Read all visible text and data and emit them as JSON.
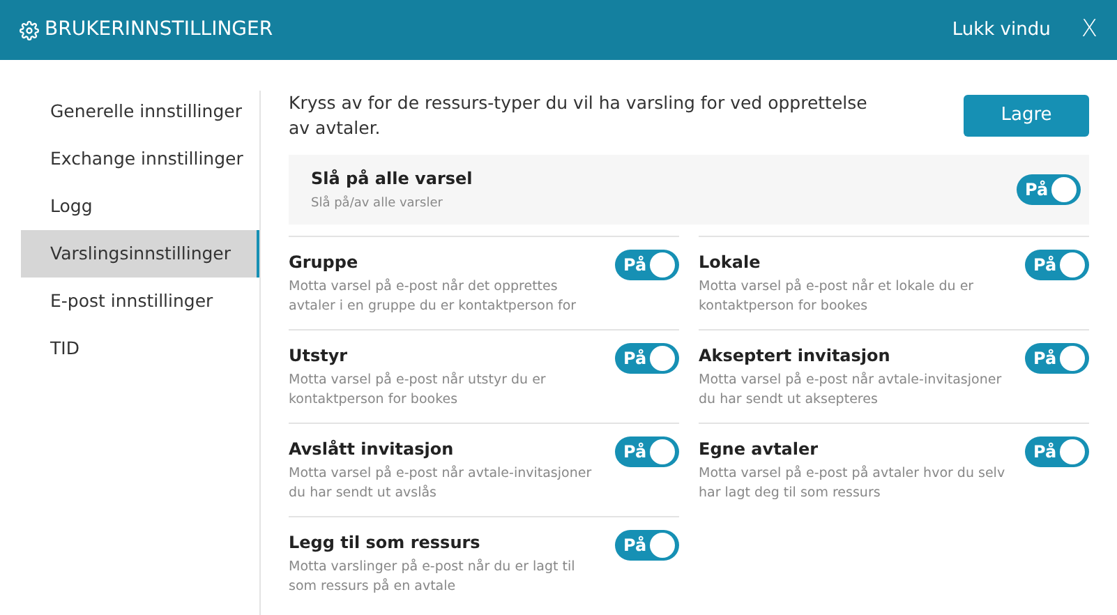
{
  "header": {
    "title": "BRUKERINNSTILLINGER",
    "close_label": "Lukk vindu",
    "close_icon": "X"
  },
  "sidebar": {
    "items": [
      {
        "label": "Generelle innstillinger",
        "selected": false
      },
      {
        "label": "Exchange innstillinger",
        "selected": false
      },
      {
        "label": "Logg",
        "selected": false
      },
      {
        "label": "Varslingsinnstillinger",
        "selected": true
      },
      {
        "label": "E-post innstillinger",
        "selected": false
      },
      {
        "label": "TID",
        "selected": false
      }
    ]
  },
  "intro": "Kryss av for de ressurs-typer du vil ha varsling for ved opprettelse av avtaler.",
  "save_button": "Lagre",
  "master": {
    "title": "Slå på alle varsel",
    "description": "Slå på/av alle varsler",
    "on": true,
    "toggle_label": "På"
  },
  "settings": [
    {
      "title": "Gruppe",
      "description": "Motta varsel på e-post når det opprettes avtaler i en gruppe du er kontaktperson for",
      "on": true,
      "toggle_label": "På"
    },
    {
      "title": "Lokale",
      "description": "Motta varsel på e-post når et lokale du er kontaktperson for bookes",
      "on": true,
      "toggle_label": "På"
    },
    {
      "title": "Utstyr",
      "description": "Motta varsel på e-post når utstyr du er kontaktperson for bookes",
      "on": true,
      "toggle_label": "På"
    },
    {
      "title": "Akseptert invitasjon",
      "description": "Motta varsel på e-post når avtale-invitasjoner du har sendt ut aksepteres",
      "on": true,
      "toggle_label": "På"
    },
    {
      "title": "Avslått invitasjon",
      "description": "Motta varsel på e-post når avtale-invitasjoner du har sendt ut avslås",
      "on": true,
      "toggle_label": "På"
    },
    {
      "title": "Egne avtaler",
      "description": "Motta varsel på e-post på avtaler hvor du selv har lagt deg til som ressurs",
      "on": true,
      "toggle_label": "På"
    },
    {
      "title": "Legg til som ressurs",
      "description": "Motta varslinger på e-post når du er lagt til som ressurs på en avtale",
      "on": true,
      "toggle_label": "På"
    }
  ]
}
